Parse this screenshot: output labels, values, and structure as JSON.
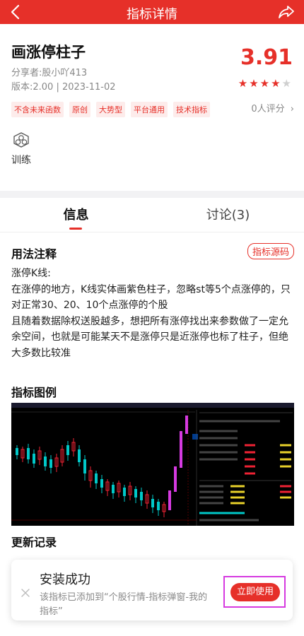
{
  "header": {
    "title": "指标详情",
    "back_icon": "back-icon",
    "share_icon": "share-icon"
  },
  "indicator": {
    "name": "画涨停柱子",
    "sharer": "分享者:股小吖413",
    "version_date": "版本:2.00 | 2023-11-02",
    "score": "3.91",
    "stars": 4,
    "stars_total": 5,
    "tags": [
      "不含未来函数",
      "原创",
      "大势型",
      "平台通用",
      "技术指标"
    ],
    "rating_text": "0人评分",
    "train_label": "训练",
    "accent_color": "#e63029"
  },
  "tabs": [
    {
      "label": "信息",
      "active": true
    },
    {
      "label": "讨论(3)",
      "active": false
    }
  ],
  "usage": {
    "title": "用法注释",
    "source_button": "指标源码",
    "paragraphs": [
      "涨停K线:",
      "在涨停的地方，K线实体画紫色柱子，忽略st等5个点涨停的，只对正常30、20、10个点涨停的个股",
      "且随着数据除权送股越多，想把所有涨停找出来参数做了一定允余空间，也就是可能某天不是涨停只是近涨停也标了柱子，但绝大多数比较准"
    ]
  },
  "figure_section": {
    "title": "指标图例"
  },
  "update_section": {
    "title": "更新记录"
  },
  "toast": {
    "title": "安装成功",
    "message": "该指标已添加到“个股行情-指标弹窗-我的指标”",
    "use_button": "立即使用"
  }
}
